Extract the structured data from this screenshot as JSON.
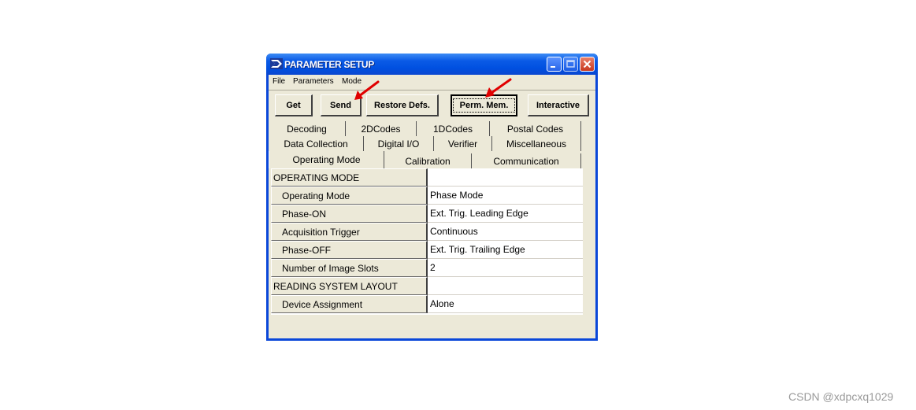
{
  "window": {
    "title": "PARAMETER SETUP"
  },
  "menu": [
    "File",
    "Parameters",
    "Mode"
  ],
  "toolbar": {
    "get_label": "Get",
    "send_label": "Send",
    "restore_label": "Restore Defs.",
    "perm_mem_label": "Perm. Mem.",
    "interactive_label": "Interactive"
  },
  "tabs": {
    "row1": [
      "Decoding",
      "2DCodes",
      "1DCodes",
      "Postal Codes"
    ],
    "row2": [
      "Data Collection",
      "Digital I/O",
      "Verifier",
      "Miscellaneous"
    ],
    "row3": [
      "Operating Mode",
      "Calibration",
      "Communication"
    ],
    "selected": "Operating Mode"
  },
  "grid": {
    "rows": [
      {
        "label": "OPERATING MODE",
        "value": "",
        "kind": "header"
      },
      {
        "label": "Operating Mode",
        "value": "Phase Mode",
        "kind": "item"
      },
      {
        "label": "Phase-ON",
        "value": "Ext. Trig. Leading Edge",
        "kind": "item"
      },
      {
        "label": "Acquisition Trigger",
        "value": "Continuous",
        "kind": "item"
      },
      {
        "label": "Phase-OFF",
        "value": "Ext. Trig. Trailing Edge",
        "kind": "item"
      },
      {
        "label": "Number of Image Slots",
        "value": "2",
        "kind": "item"
      },
      {
        "label": "READING SYSTEM LAYOUT",
        "value": "",
        "kind": "header"
      },
      {
        "label": "Device Assignment",
        "value": "Alone",
        "kind": "item"
      }
    ]
  },
  "watermark": "CSDN @xdpcxq1029",
  "colors": {
    "titlebar": "#0054e3",
    "window_body": "#ece9d8",
    "annotation_arrow": "#e00000"
  }
}
